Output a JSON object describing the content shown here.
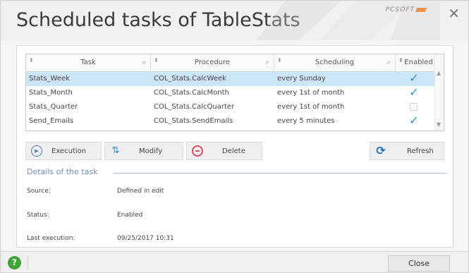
{
  "window": {
    "title": "Scheduled tasks of TableStats",
    "logo_text": "PCSOFT",
    "close_glyph": "✕"
  },
  "grid": {
    "columns": [
      {
        "label": "Task"
      },
      {
        "label": "Procedure"
      },
      {
        "label": "Scheduling"
      },
      {
        "label": "Enabled"
      }
    ],
    "rows": [
      {
        "task": "Stats_Week",
        "procedure": "COL_Stats.CalcWeek",
        "scheduling": "every Sunday",
        "enabled": true,
        "selected": true
      },
      {
        "task": "Stats_Month",
        "procedure": "COL_Stats.CalcMonth",
        "scheduling": "every 1st of month",
        "enabled": true,
        "selected": false
      },
      {
        "task": "Stats_Quarter",
        "procedure": "COL_Stats.CalcQuarter",
        "scheduling": "every 1st of month",
        "enabled": false,
        "selected": false
      },
      {
        "task": "Send_Emails",
        "procedure": "COL_Stats.SendEmails",
        "scheduling": "every 5 minutes",
        "enabled": true,
        "selected": false
      }
    ]
  },
  "toolbar": {
    "execution_label": "Execution",
    "modify_label": "Modify",
    "delete_label": "Delete",
    "refresh_label": "Refresh"
  },
  "details": {
    "header": "Details of the task",
    "source_label": "Source:",
    "source_value": "Defined in edit",
    "status_label": "Status:",
    "status_value": "Enabled",
    "last_exec_label": "Last execution:",
    "last_exec_value": "09/25/2017 10:31"
  },
  "footer": {
    "help_glyph": "?",
    "close_label": "Close"
  },
  "colors": {
    "selection": "#cde6f7",
    "check": "#1d8fd8",
    "accent": "#6c8fb4",
    "help": "#3fa535",
    "delete": "#e04b5e"
  }
}
